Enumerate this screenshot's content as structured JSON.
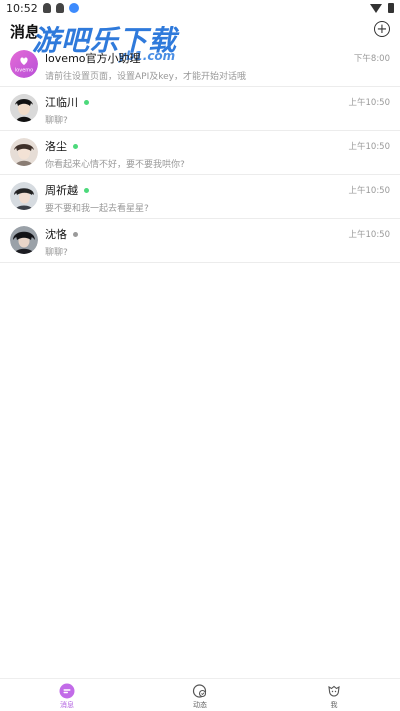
{
  "status_bar": {
    "time": "10:52"
  },
  "header": {
    "title": "消息",
    "watermark": "游吧乐下载",
    "watermark_sub": "yb1.com",
    "add_symbol": "+"
  },
  "colors": {
    "online": "#4cd97b",
    "offline": "#9a9a9a",
    "accent": "#b05de0"
  },
  "conversations": [
    {
      "name": "lovemo官方小助理",
      "preview": "请前往设置页面，设置API及key，才能开始对话哦",
      "time": "下午8:00",
      "status": "none",
      "avatar_label": "lovemo",
      "avatar_icon": "heart-icon"
    },
    {
      "name": "江临川",
      "preview": "聊聊?",
      "time": "上午10:50",
      "status": "online"
    },
    {
      "name": "洛尘",
      "preview": "你看起来心情不好，要不要我哄你?",
      "time": "上午10:50",
      "status": "online"
    },
    {
      "name": "周祈越",
      "preview": "要不要和我一起去看星星?",
      "time": "上午10:50",
      "status": "online"
    },
    {
      "name": "沈恪",
      "preview": "聊聊?",
      "time": "上午10:50",
      "status": "offline"
    }
  ],
  "bottom_nav": {
    "messages": "消息",
    "moments": "动态",
    "me": "我"
  }
}
